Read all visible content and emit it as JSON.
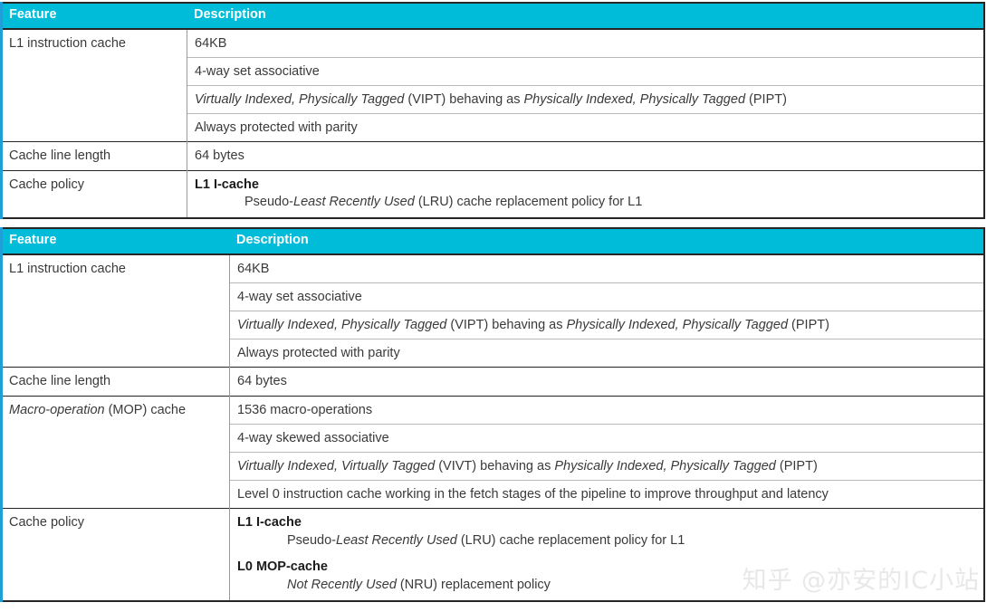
{
  "accent_color": "#00bcd8",
  "border_color": "#262626",
  "watermark": "知乎 @亦安的IC小站",
  "table_1": {
    "headers": {
      "feature": "Feature",
      "description": "Description"
    },
    "rows": [
      {
        "feature": "L1 instruction cache",
        "descriptions": [
          {
            "plain": "64KB"
          },
          {
            "plain": "4-way set associative"
          },
          {
            "rich": [
              {
                "text": "Virtually Indexed, Physically Tagged",
                "style": "italic"
              },
              {
                "text": " (VIPT) behaving as ",
                "style": "normal"
              },
              {
                "text": "Physically Indexed, Physically Tagged",
                "style": "italic"
              },
              {
                "text": " (PIPT)",
                "style": "normal"
              }
            ]
          },
          {
            "plain": "Always protected with parity"
          }
        ]
      },
      {
        "feature": "Cache line length",
        "descriptions": [
          {
            "plain": "64 bytes"
          }
        ]
      },
      {
        "feature": "Cache policy",
        "policies": [
          {
            "title": "L1 I-cache",
            "detail": [
              {
                "text": "Pseudo-",
                "style": "normal"
              },
              {
                "text": "Least Recently Used",
                "style": "italic"
              },
              {
                "text": " (LRU) cache replacement policy for L1",
                "style": "normal"
              }
            ]
          }
        ]
      }
    ]
  },
  "table_2": {
    "headers": {
      "feature": "Feature",
      "description": "Description"
    },
    "rows": [
      {
        "feature": "L1 instruction cache",
        "descriptions": [
          {
            "plain": "64KB"
          },
          {
            "plain": "4-way set associative"
          },
          {
            "rich": [
              {
                "text": "Virtually Indexed, Physically Tagged",
                "style": "italic"
              },
              {
                "text": " (VIPT) behaving as ",
                "style": "normal"
              },
              {
                "text": "Physically Indexed, Physically Tagged",
                "style": "italic"
              },
              {
                "text": " (PIPT)",
                "style": "normal"
              }
            ]
          },
          {
            "plain": "Always protected with parity"
          }
        ]
      },
      {
        "feature": "Cache line length",
        "descriptions": [
          {
            "plain": "64 bytes"
          }
        ]
      },
      {
        "feature_rich": [
          {
            "text": "Macro-operation",
            "style": "italic"
          },
          {
            "text": " (MOP) cache",
            "style": "normal"
          }
        ],
        "descriptions": [
          {
            "plain": "1536 macro-operations"
          },
          {
            "plain": "4-way skewed associative"
          },
          {
            "rich": [
              {
                "text": "Virtually Indexed, Virtually Tagged",
                "style": "italic"
              },
              {
                "text": " (VIVT) behaving as ",
                "style": "normal"
              },
              {
                "text": "Physically Indexed, Physically Tagged",
                "style": "italic"
              },
              {
                "text": " (PIPT)",
                "style": "normal"
              }
            ]
          },
          {
            "plain": "Level 0 instruction cache working in the fetch stages of the pipeline to improve throughput and latency"
          }
        ]
      },
      {
        "feature": "Cache policy",
        "policies": [
          {
            "title": "L1 I-cache",
            "detail": [
              {
                "text": "Pseudo-",
                "style": "normal"
              },
              {
                "text": "Least Recently Used",
                "style": "italic"
              },
              {
                "text": " (LRU) cache replacement policy for L1",
                "style": "normal"
              }
            ]
          },
          {
            "title": "L0 MOP-cache",
            "detail": [
              {
                "text": "Not Recently Used",
                "style": "italic"
              },
              {
                "text": " (NRU) replacement policy",
                "style": "normal"
              }
            ]
          }
        ]
      }
    ]
  }
}
